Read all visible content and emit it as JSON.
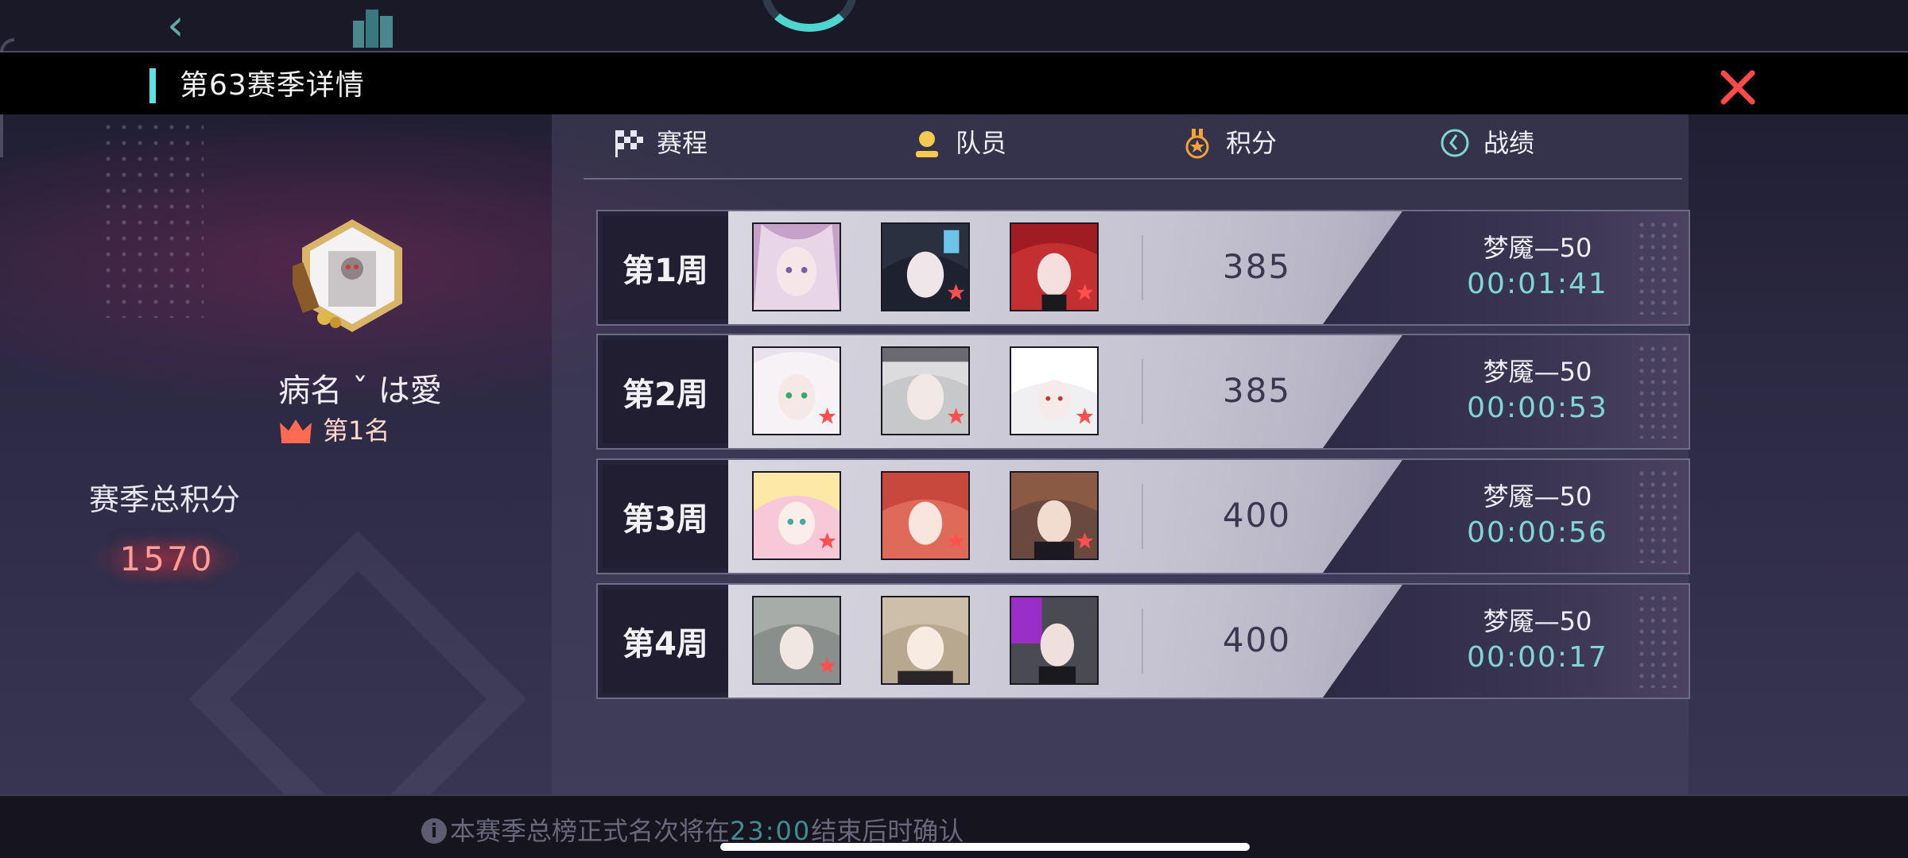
{
  "header": {
    "title": "第63赛季详情",
    "close_icon": "close-icon"
  },
  "player": {
    "name": "病名 ˇ は愛",
    "rank": "第1名",
    "season_total_label": "赛季总积分",
    "season_total_value": "1570"
  },
  "tabs": [
    {
      "label": "赛程",
      "icon": "checkered-flag-icon"
    },
    {
      "label": "队员",
      "icon": "member-icon"
    },
    {
      "label": "积分",
      "icon": "medal-icon"
    },
    {
      "label": "战绩",
      "icon": "record-clock-icon"
    }
  ],
  "weeks": [
    {
      "label": "第1周",
      "score": "385",
      "mode": "梦魇—50",
      "time": "00:01:41"
    },
    {
      "label": "第2周",
      "score": "385",
      "mode": "梦魇—50",
      "time": "00:00:53"
    },
    {
      "label": "第3周",
      "score": "400",
      "mode": "梦魇—50",
      "time": "00:00:56"
    },
    {
      "label": "第4周",
      "score": "400",
      "mode": "梦魇—50",
      "time": "00:00:17"
    }
  ],
  "notice": {
    "prefix": "本赛季总榜正式名次将在",
    "time": "23:00",
    "suffix": "结束后时确认"
  },
  "colors": {
    "accent_cyan": "#5fe1e0",
    "close_red": "#ff4a4a",
    "time_teal": "#7fd6d2",
    "total_red": "#ff9e98"
  }
}
